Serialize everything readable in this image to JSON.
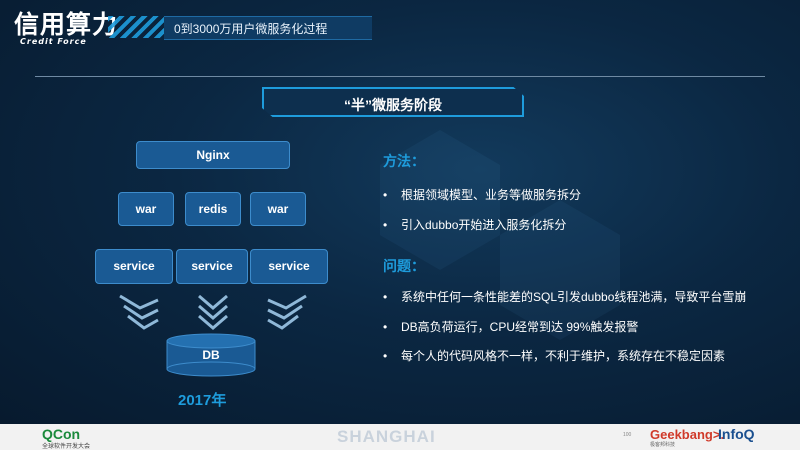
{
  "logo": {
    "cn": "信用算力",
    "en": "Credit Force"
  },
  "header": {
    "title": "0到3000万用户微服务化过程"
  },
  "section_title": "“半”微服务阶段",
  "diagram": {
    "nginx": "Nginx",
    "middle": [
      "war",
      "redis",
      "war"
    ],
    "services": [
      "service",
      "service",
      "service"
    ],
    "db": "DB",
    "year": "2017年"
  },
  "method": {
    "heading": "方法：",
    "items": [
      "根据领域模型、业务等做服务拆分",
      "引入dubbo开始进入服务化拆分"
    ]
  },
  "problems": {
    "heading": "问题：",
    "items": [
      "系统中任何一条性能差的SQL引发dubbo线程池满，导致平台雪崩",
      "DB高负荷运行，CPU经常到达 99%触发报警",
      "每个人的代码风格不一样，不利于维护，系统存在不稳定因素"
    ]
  },
  "bullet_char": "•",
  "footer": {
    "qcon": "QCon",
    "qcon_sub": "全球软件开发大会",
    "city": "SHANGHAI",
    "geekbang": "Geekbang>.",
    "geekbang_sub": "极客邦科技",
    "infoq": "InfoQ",
    "mark": "100"
  },
  "colors": {
    "accent": "#1e9cdc",
    "box": "#1a5a94",
    "background": "#0b2742"
  }
}
